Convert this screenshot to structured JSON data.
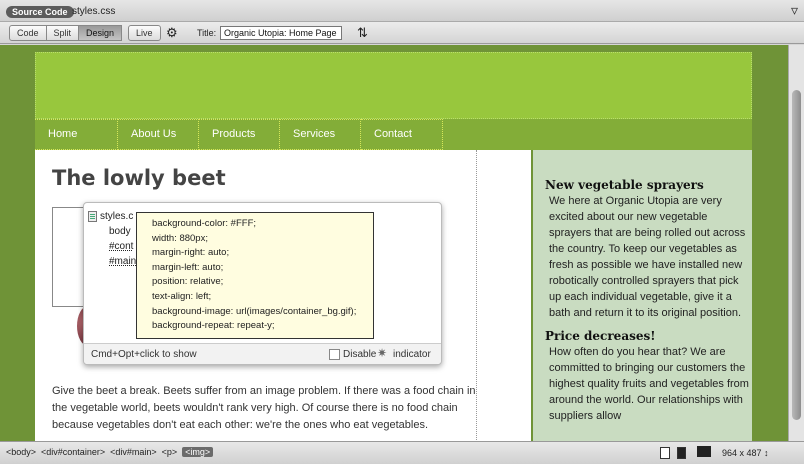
{
  "file_tabs": {
    "source_code": "Source Code",
    "css_file": "styles.css"
  },
  "toolbar": {
    "views": [
      "Code",
      "Split",
      "Design"
    ],
    "active_view": "Design",
    "live": "Live",
    "title_label": "Title:",
    "title_value": "Organic Utopia: Home Page"
  },
  "nav": {
    "items": [
      "Home",
      "About Us",
      "Products",
      "Services",
      "Contact"
    ]
  },
  "main": {
    "heading": "The lowly beet",
    "body": "Give the beet a break. Beets suffer from an image problem. If there was a food chain in the vegetable world, beets wouldn't rank very high. Of course there is no food chain because vegetables don't eat each other: we're the ones who eat vegetables."
  },
  "sidebar": {
    "h1": "New vegetable sprayers",
    "p1": "We here at Organic Utopia are very excited about our new vegetable sprayers that are being rolled out across the country. To keep our vegetables as fresh as possible we have installed new robotically controlled sprayers that pick up each individual vegetable, give it a bath and return it to its original position.",
    "h2": "Price decreases!",
    "p2": "How often do you hear that? We are committed to bringing our customers the highest quality fruits and vegetables from around the world. Our relationships with suppliers allow"
  },
  "popup": {
    "tree": [
      "styles.c",
      "body",
      "#cont",
      "#main"
    ],
    "rules": [
      "background-color: #FFF;",
      "width: 880px;",
      "margin-right: auto;",
      "margin-left: auto;",
      "position: relative;",
      "text-align: left;",
      "background-image: url(images/container_bg.gif);",
      "background-repeat: repeat-y;"
    ],
    "hint": "Cmd+Opt+click to show",
    "disable": "Disable",
    "indicator": "indicator"
  },
  "statusbar": {
    "tags": [
      "<body>",
      "<div#container>",
      "<div#main>",
      "<p>",
      "<img>"
    ],
    "selected_tag": "<img>",
    "window_size": "964 x 487 ↕"
  },
  "colors": {
    "canvas_bg": "#6f9337",
    "header": "#98c73d",
    "nav": "#83ad38",
    "sidebar": "#c9dcc1",
    "tooltip": "#fffde0"
  }
}
